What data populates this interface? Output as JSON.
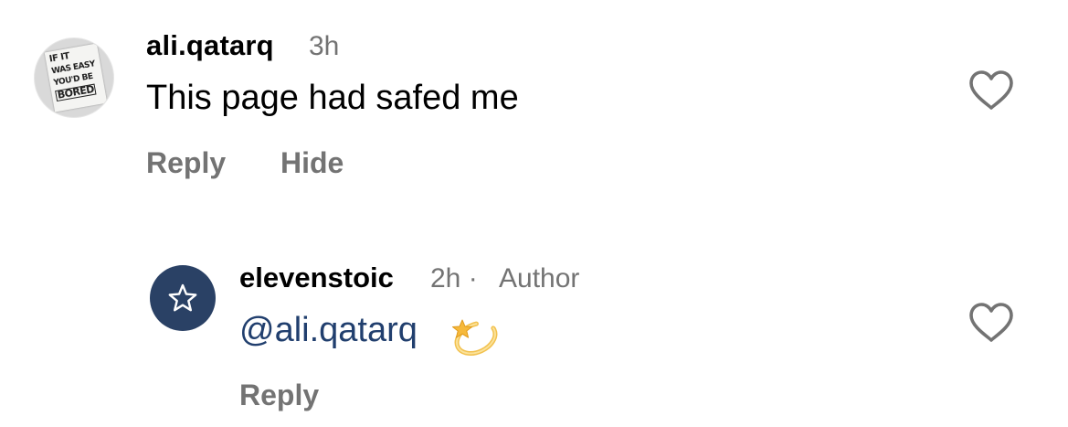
{
  "comments": [
    {
      "username": "ali.qatarq",
      "time": "3h",
      "text": "This page had safed me",
      "actions": {
        "reply": "Reply",
        "hide": "Hide"
      },
      "avatar": {
        "sign_text": [
          "IF IT",
          "WAS EASY",
          "YOU'D BE",
          "BORED"
        ]
      },
      "liked": false
    },
    {
      "username": "elevenstoic",
      "time": "2h",
      "separator": "·",
      "badge": "Author",
      "mention": "@ali.qatarq",
      "emoji": "dizzy-star",
      "actions": {
        "reply": "Reply"
      },
      "avatar": {
        "icon": "star-outline-icon",
        "color": "#2a4165"
      },
      "liked": false
    }
  ],
  "colors": {
    "text": "#000000",
    "muted": "#737373",
    "mention": "#213f6e",
    "avatar_bg": "#2a4165"
  }
}
